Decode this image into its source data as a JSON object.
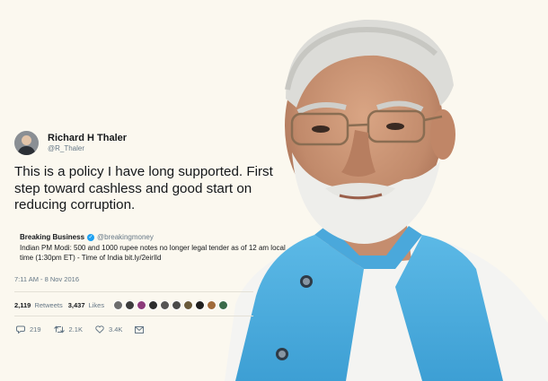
{
  "tweet": {
    "author_name": "Richard H Thaler",
    "author_handle": "@R_Thaler",
    "text": "This is a policy I have long supported. First step toward cashless and good start on reducing corruption.",
    "quoted": {
      "name": "Breaking Business",
      "handle": "@breakingmoney",
      "text": "Indian PM Modi: 500 and 1000 rupee notes no longer legal tender as of 12 am local time (1:30pm ET) - Time of India bit.ly/2eirIld"
    },
    "timestamp": "7:11 AM - 8 Nov 2016",
    "stats": {
      "retweets_count": "2,119",
      "retweets_label": "Retweets",
      "likes_count": "3,437",
      "likes_label": "Likes"
    },
    "actions": {
      "reply_count": "219",
      "retweet_count": "2.1K",
      "like_count": "3.4K"
    }
  },
  "colors": {
    "background": "#fbf8ef",
    "verified": "#1da1f2",
    "vest": "#4fb0df",
    "secondary_text": "#657786"
  },
  "icons": [
    "verified-badge-icon",
    "reply-icon",
    "retweet-icon",
    "like-icon",
    "message-icon"
  ]
}
